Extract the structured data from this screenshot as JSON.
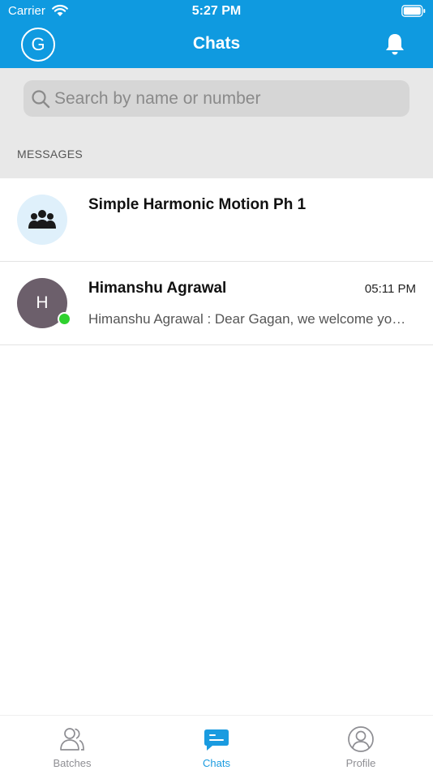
{
  "status_bar": {
    "carrier": "Carrier",
    "time": "5:27 PM"
  },
  "nav": {
    "title": "Chats",
    "avatar_initial": "G"
  },
  "search": {
    "placeholder": "Search by name or number",
    "value": ""
  },
  "section_title": "MESSAGES",
  "chats": [
    {
      "name": "Simple Harmonic Motion Ph 1",
      "type": "group",
      "time": "",
      "preview": ""
    },
    {
      "name": "Himanshu Agrawal",
      "type": "user",
      "initial": "H",
      "time": "05:11 PM",
      "preview": "Himanshu Agrawal : Dear Gagan, we welcome you to Simple Harmonic Motion",
      "online": true
    }
  ],
  "tabs": [
    {
      "label": "Batches",
      "icon": "people-icon",
      "active": false
    },
    {
      "label": "Chats",
      "icon": "chat-bubble-icon",
      "active": true
    },
    {
      "label": "Profile",
      "icon": "profile-icon",
      "active": false
    }
  ],
  "colors": {
    "accent": "#0f9ae0",
    "online": "#2fd12f",
    "user_avatar": "#6c5f6b",
    "group_avatar_bg": "#dff0fb"
  }
}
